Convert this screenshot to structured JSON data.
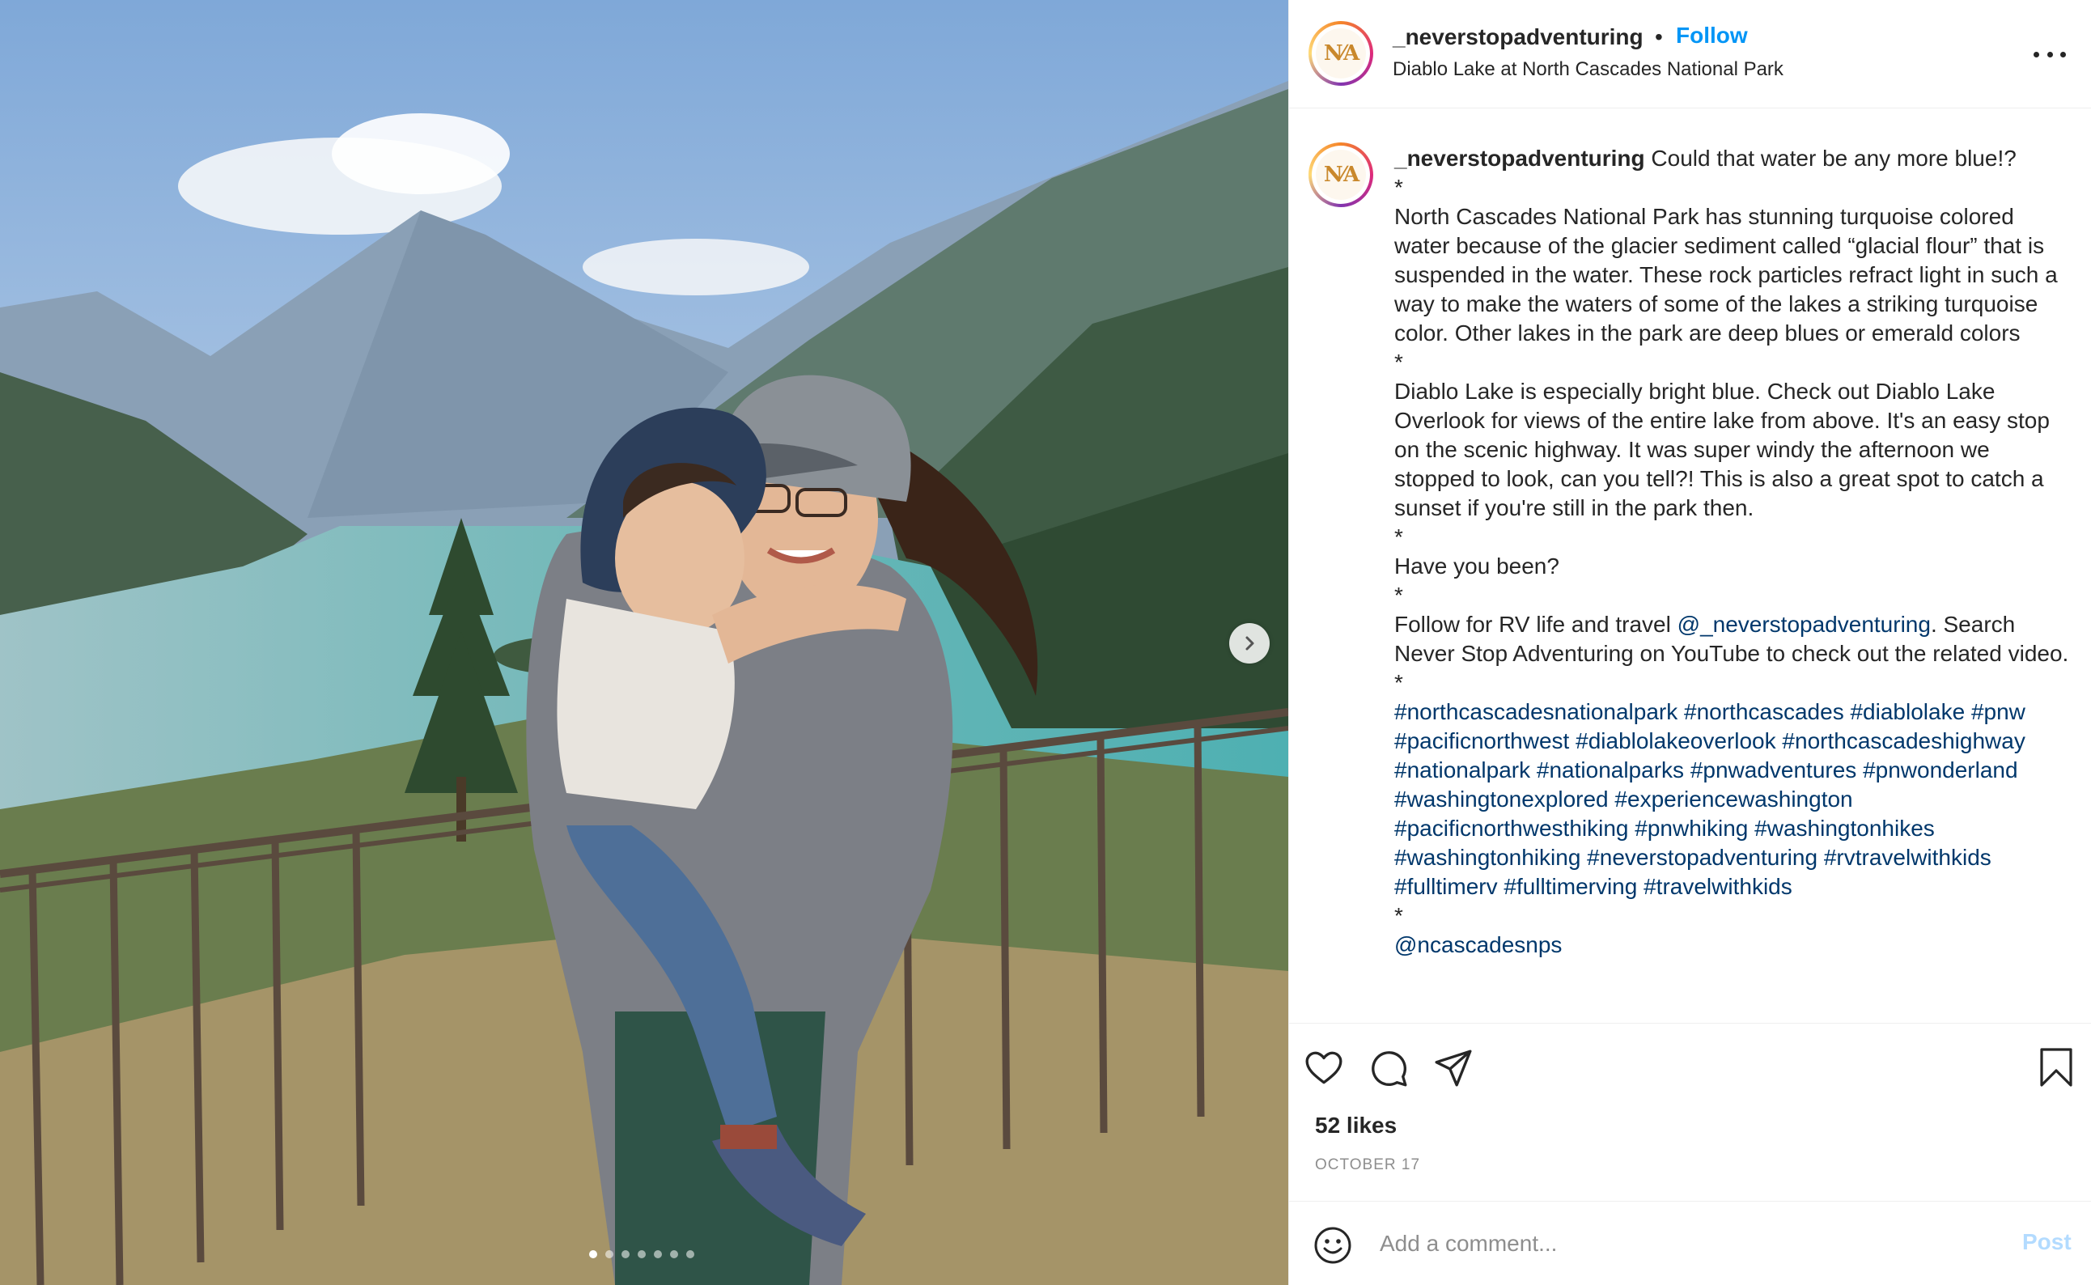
{
  "photo": {
    "carousel_dot_count": 7,
    "active_dot_index": 0
  },
  "header": {
    "username": "_neverstopadventuring",
    "separator": "•",
    "follow_label": "Follow",
    "location": "Diablo Lake at North Cascades National Park",
    "avatar_initials": "N⁄A"
  },
  "caption": {
    "username": "_neverstopadventuring",
    "first_line": " Could that water be any more blue!?",
    "body": [
      "*",
      "North Cascades National Park has stunning turquoise colored water because of the glacier sediment called “glacial flour” that is suspended in the water. These rock particles refract light in such a way to make the waters of some of the lakes a striking turquoise color. Other lakes in the park are deep blues or emerald colors",
      "*",
      "Diablo Lake is especially bright blue. Check out Diablo Lake Overlook for views of the entire lake from above. It's an easy stop on the scenic highway. It was super windy the afternoon we stopped to look, can you tell?! This is also a great spot to catch a sunset if you're still in the park then.",
      "*",
      "Have you been?",
      "*"
    ],
    "follow_pre": "Follow for RV life and travel ",
    "follow_mention": "@_neverstopadventuring",
    "follow_post": ". Search Never Stop Adventuring on YouTube to check out the related video.",
    "star_after_follow": "*",
    "hashtags": [
      "#northcascadesnationalpark",
      "#northcascades",
      "#diablolake",
      "#pnw",
      "#pacificnorthwest",
      "#diablolakeoverlook",
      "#northcascadeshighway",
      "#nationalpark",
      "#nationalparks",
      "#pnwadventures",
      "#pnwonderland",
      "#washingtonexplored",
      "#experiencewashington",
      "#pacificnorthwesthiking",
      "#pnwhiking",
      "#washingtonhikes",
      "#washingtonhiking",
      "#neverstopadventuring",
      "#rvtravelwithkids",
      "#fulltimerv",
      "#fulltimerving",
      "#travelwithkids"
    ],
    "star_after_tags": "*",
    "final_mention": "@ncascadesnps"
  },
  "actions": {
    "likes": "52 likes",
    "date": "OCTOBER 17"
  },
  "comment": {
    "placeholder": "Add a comment...",
    "post_label": "Post"
  },
  "colors": {
    "link": "#00376b",
    "follow": "#0095f6",
    "post_disabled": "#b3dbff",
    "muted": "#8e8e8e"
  }
}
